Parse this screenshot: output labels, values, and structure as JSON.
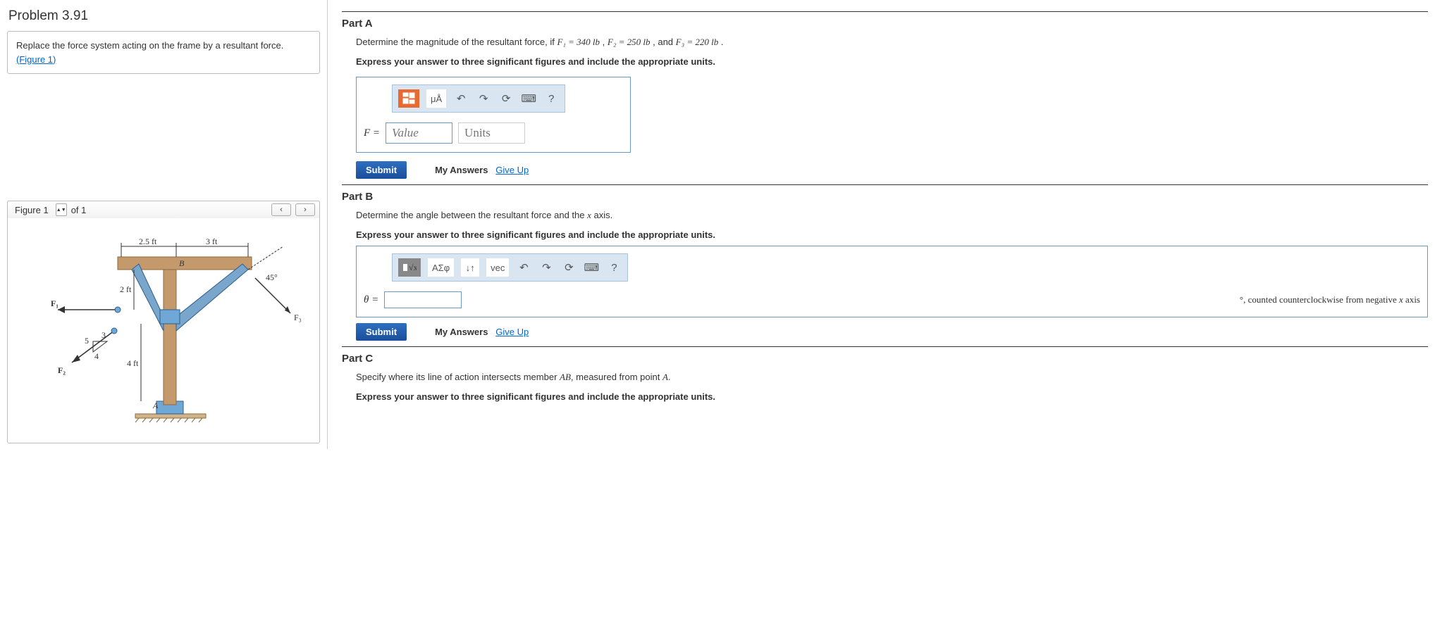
{
  "problem": {
    "title": "Problem 3.91",
    "statement": "Replace the force system acting on the frame by a resultant force.",
    "figure_link": "(Figure 1)"
  },
  "figure_nav": {
    "label": "Figure 1",
    "of_text": "of 1",
    "prev": "‹",
    "next": "›"
  },
  "figure_labels": {
    "d1": "2.5 ft",
    "d2": "3 ft",
    "d3": "2 ft",
    "d4": "4 ft",
    "ang": "45°",
    "B": "B",
    "A": "A",
    "F1": "F₁",
    "F2": "F₂",
    "F3": "F₃",
    "tri5": "5",
    "tri3": "3",
    "tri4": "4"
  },
  "partA": {
    "title": "Part A",
    "desc_prefix": "Determine the magnitude of the resultant force, if ",
    "f1": "F₁ = 340 lb",
    "sep1": " , ",
    "f2": "F₂ = 250 lb",
    "sep2": " , and ",
    "f3": "F₃ = 220 lb",
    "desc_suffix": " .",
    "instr": "Express your answer to three significant figures and include the appropriate units.",
    "var": "F =",
    "value_ph": "Value",
    "units_ph": "Units",
    "tb_mu": "μÅ",
    "tb_q": "?"
  },
  "partB": {
    "title": "Part B",
    "desc": "Determine the angle between the resultant force and the x axis.",
    "instr": "Express your answer to three significant figures and include the appropriate units.",
    "var": "θ =",
    "suffix": "°, counted counterclockwise from negative x axis",
    "tb_aes": "ΑΣφ",
    "tb_vec": "vec",
    "tb_arrows": "↓↑",
    "tb_q": "?"
  },
  "partC": {
    "title": "Part C",
    "desc": "Specify where its line of action intersects member AB, measured from point A.",
    "instr": "Express your answer to three significant figures and include the appropriate units."
  },
  "buttons": {
    "submit": "Submit",
    "my_answers": "My Answers",
    "give_up": "Give Up"
  }
}
